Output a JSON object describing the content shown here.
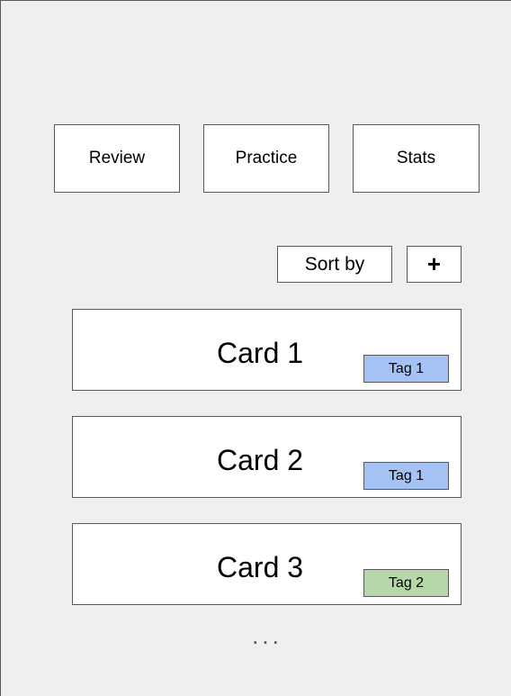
{
  "toolbar": {
    "tabs": [
      {
        "label": "Review"
      },
      {
        "label": "Practice"
      },
      {
        "label": "Stats"
      }
    ],
    "sort_label": "Sort by",
    "add_label": "+"
  },
  "cards": [
    {
      "title": "Card 1",
      "tag": {
        "label": "Tag 1",
        "color": "#a4c2f4"
      }
    },
    {
      "title": "Card 2",
      "tag": {
        "label": "Tag 1",
        "color": "#a4c2f4"
      }
    },
    {
      "title": "Card 3",
      "tag": {
        "label": "Tag 2",
        "color": "#b6d7a8"
      }
    }
  ],
  "more_indicator": "...",
  "colors": {
    "background": "#efefef",
    "border": "#595959",
    "tag_blue": "#a4c2f4",
    "tag_green": "#b6d7a8"
  }
}
